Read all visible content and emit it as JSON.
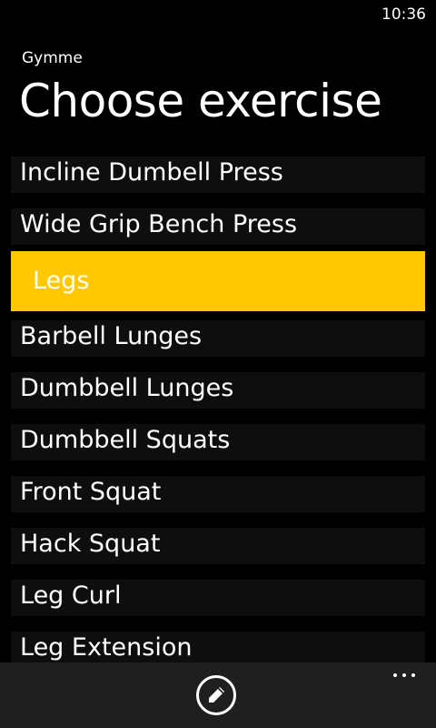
{
  "status_bar": {
    "time": "10:36"
  },
  "header": {
    "app_name": "Gymme",
    "title": "Choose exercise"
  },
  "list": {
    "items": [
      {
        "label": "Incline Dumbell Press",
        "kind": "item"
      },
      {
        "label": "Wide Grip Bench Press",
        "kind": "item"
      },
      {
        "label": "Legs",
        "kind": "group-header"
      },
      {
        "label": "Barbell Lunges",
        "kind": "item"
      },
      {
        "label": "Dumbbell Lunges",
        "kind": "item"
      },
      {
        "label": "Dumbbell Squats",
        "kind": "item"
      },
      {
        "label": "Front Squat",
        "kind": "item"
      },
      {
        "label": "Hack Squat",
        "kind": "item"
      },
      {
        "label": "Leg Curl",
        "kind": "item"
      },
      {
        "label": "Leg Extension",
        "kind": "item"
      }
    ]
  },
  "app_bar": {
    "edit_icon": "pencil-icon",
    "more_icon": "ellipsis-icon"
  },
  "colors": {
    "accent": "#ffc800",
    "background": "#000000",
    "item_background": "#0e0e0e",
    "app_bar": "#1f1f1f"
  }
}
